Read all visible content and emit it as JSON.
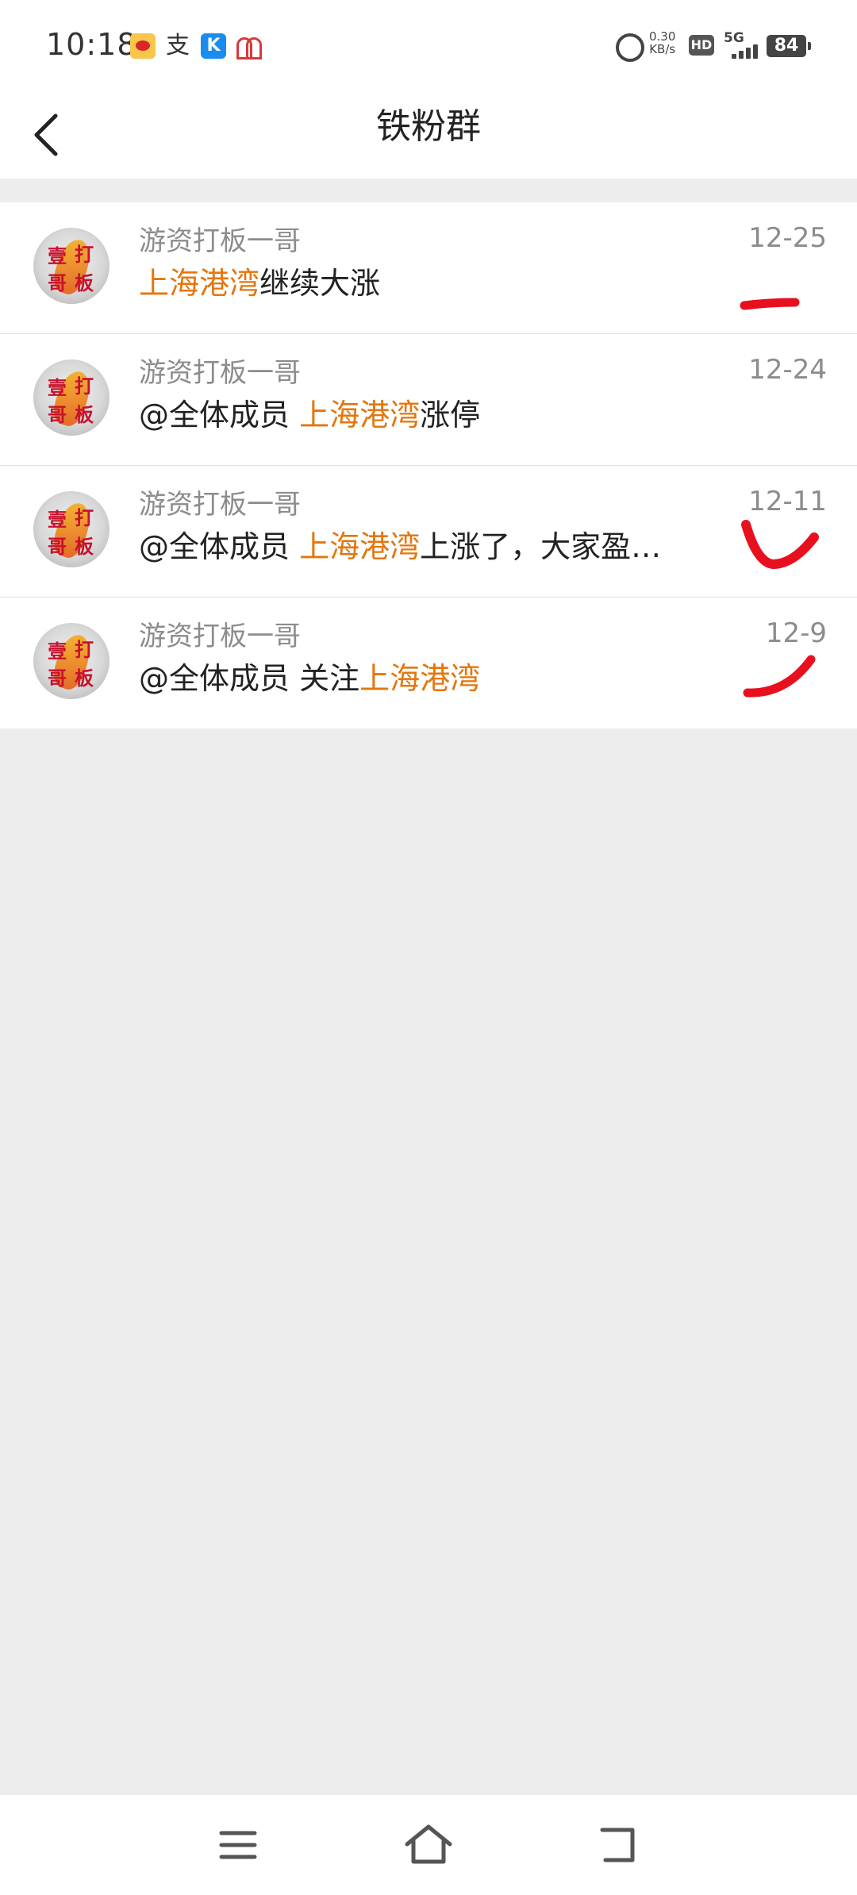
{
  "status_bar": {
    "time": "10:18",
    "net_speed_value": "0.30",
    "net_speed_unit": "KB/s",
    "hd": "HD",
    "network": "5G",
    "battery": "84",
    "apps": [
      "weibo-icon",
      "alipay-icon",
      "k-app-icon",
      "bank-icon"
    ]
  },
  "header": {
    "title": "铁粉群"
  },
  "messages": [
    {
      "sender": "游资打板一哥",
      "prefix": "",
      "highlight": "上海港湾",
      "suffix": "继续大涨",
      "date": "12-25"
    },
    {
      "sender": "游资打板一哥",
      "prefix": "@全体成员 ",
      "highlight": "上海港湾",
      "suffix": "涨停",
      "date": "12-24"
    },
    {
      "sender": "游资打板一哥",
      "prefix": "@全体成员 ",
      "highlight": "上海港湾",
      "suffix": "上涨了，大家盈…",
      "date": "12-11"
    },
    {
      "sender": "游资打板一哥",
      "prefix": "@全体成员 关注",
      "highlight": "上海港湾",
      "suffix": "",
      "date": "12-9"
    }
  ],
  "avatar_chars": [
    "壹",
    "打",
    "哥",
    "板"
  ],
  "colors": {
    "highlight": "#e4760d",
    "annotation": "#e8101e",
    "background": "#ededed"
  }
}
